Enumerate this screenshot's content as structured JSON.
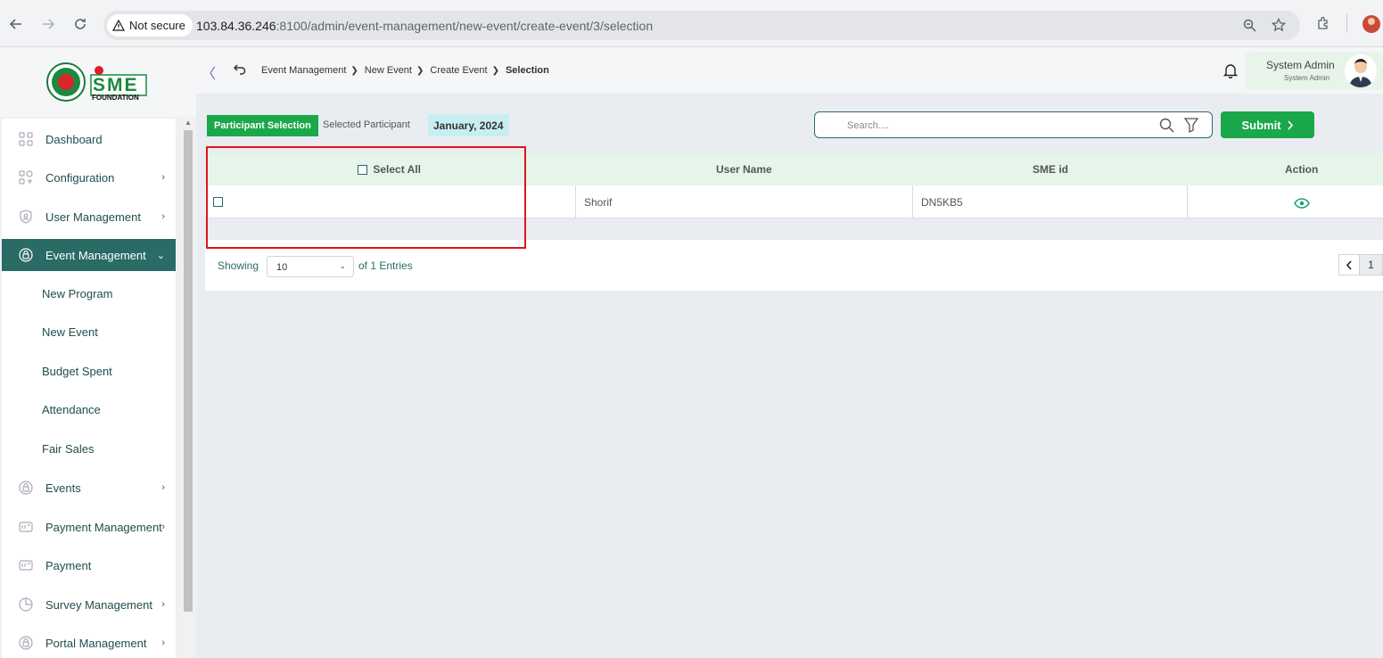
{
  "browser": {
    "security_label": "Not secure",
    "url_host": "103.84.36.246",
    "url_rest": ":8100/admin/event-management/new-event/create-event/3/selection"
  },
  "brand": {
    "logo_text": "SME",
    "logo_sub": "FOUNDATION"
  },
  "sidebar": {
    "items": [
      {
        "label": "Dashboard",
        "icon": "grid-icon"
      },
      {
        "label": "Configuration",
        "icon": "config-icon"
      },
      {
        "label": "User Management",
        "icon": "shield-icon"
      },
      {
        "label": "Event Management",
        "icon": "event-icon"
      },
      {
        "label": "Events",
        "icon": "event-icon"
      },
      {
        "label": "Payment Management",
        "icon": "card-icon"
      },
      {
        "label": "Payment",
        "icon": "card-icon"
      },
      {
        "label": "Survey Management",
        "icon": "pie-icon"
      },
      {
        "label": "Portal Management",
        "icon": "event-icon"
      }
    ],
    "sub_items": [
      "New Program",
      "New Event",
      "Budget Spent",
      "Attendance",
      "Fair Sales"
    ]
  },
  "breadcrumb": {
    "items": [
      "Event Management",
      "New Event",
      "Create Event"
    ],
    "current": "Selection"
  },
  "user": {
    "name": "System Admin",
    "role": "System Admin"
  },
  "tabs": {
    "active": "Participant Selection",
    "other": "Selected Participant"
  },
  "month_chip": "January, 2024",
  "search": {
    "placeholder": "Search...."
  },
  "submit_label": "Submit",
  "table": {
    "columns": [
      "Select All",
      "User Name",
      "SME id",
      "Action"
    ],
    "rows": [
      {
        "user_name": "Shorif",
        "sme_id": "DN5KB5"
      }
    ]
  },
  "pagination": {
    "showing_label": "Showing",
    "page_size": "10",
    "entries_label": "of 1 Entries",
    "current_page": "1"
  },
  "colors": {
    "primary": "#2a6b66",
    "accent_green": "#1aa84a",
    "highlight": "#e0141b"
  }
}
